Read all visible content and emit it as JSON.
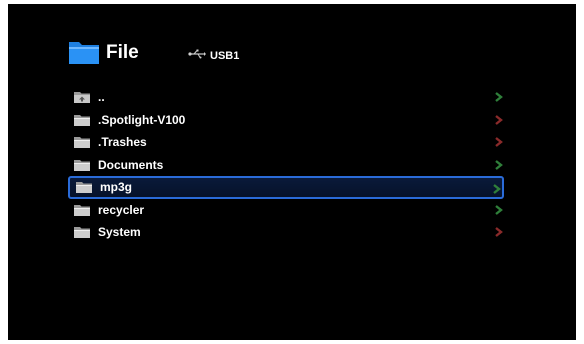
{
  "header": {
    "title": "File",
    "device": "USB1"
  },
  "colors": {
    "background": "#000000",
    "selection_border": "#2a6bd8",
    "chevron_green": "#2f7f3a",
    "chevron_red": "#8a2a2a",
    "folder_blue": "#1e7fe0"
  },
  "file_list": {
    "items": [
      {
        "label": "..",
        "icon": "parent-folder-icon",
        "chevron": "green",
        "selected": false
      },
      {
        "label": ".Spotlight-V100",
        "icon": "folder-icon",
        "chevron": "red",
        "selected": false
      },
      {
        "label": ".Trashes",
        "icon": "folder-icon",
        "chevron": "red",
        "selected": false
      },
      {
        "label": "Documents",
        "icon": "folder-icon",
        "chevron": "green",
        "selected": false
      },
      {
        "label": "mp3g",
        "icon": "folder-icon",
        "chevron": "green",
        "selected": true
      },
      {
        "label": "recycler",
        "icon": "folder-icon",
        "chevron": "green",
        "selected": false
      },
      {
        "label": "System",
        "icon": "folder-icon",
        "chevron": "red",
        "selected": false
      }
    ]
  }
}
